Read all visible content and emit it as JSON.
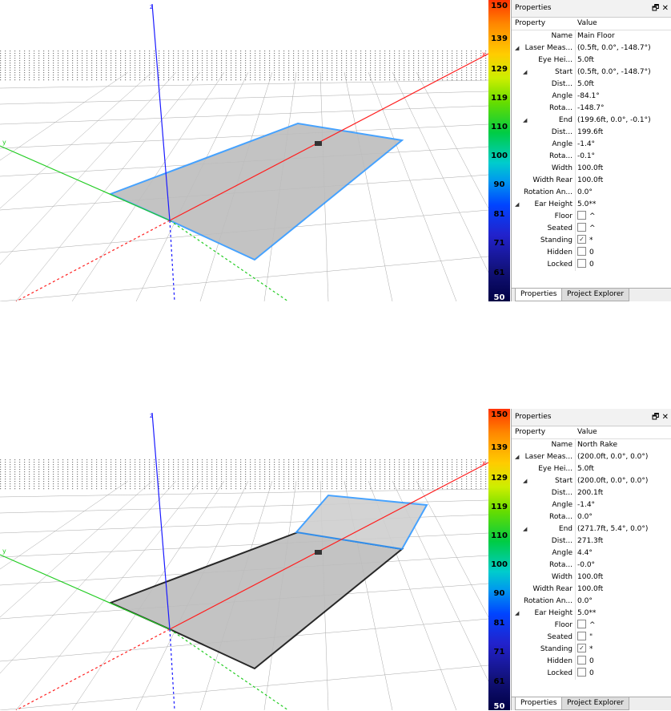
{
  "scale_labels": [
    "150",
    "139",
    "129",
    "119",
    "110",
    "100",
    "90",
    "81",
    "71",
    "61",
    "50"
  ],
  "axis_labels": {
    "z": "z",
    "y": "y",
    "x": "x"
  },
  "panels": [
    {
      "title": "Properties",
      "title_controls": "🗗 ✕",
      "col_property": "Property",
      "col_value": "Value",
      "rows": [
        {
          "name": "Name",
          "value": "Main Floor",
          "indent": 0,
          "expander": ""
        },
        {
          "name": "Laser Meas...",
          "value": "(0.5ft, 0.0°, -148.7°)",
          "indent": 0,
          "expander": "◢"
        },
        {
          "name": "Eye Hei...",
          "value": "5.0ft",
          "indent": 1,
          "expander": ""
        },
        {
          "name": "Start",
          "value": "(0.5ft, 0.0°, -148.7°)",
          "indent": 1,
          "expander": "◢"
        },
        {
          "name": "Dist...",
          "value": "5.0ft",
          "indent": 2,
          "expander": ""
        },
        {
          "name": "Angle",
          "value": "-84.1°",
          "indent": 2,
          "expander": ""
        },
        {
          "name": "Rota...",
          "value": "-148.7°",
          "indent": 2,
          "expander": ""
        },
        {
          "name": "End",
          "value": "(199.6ft, 0.0°, -0.1°)",
          "indent": 1,
          "expander": "◢"
        },
        {
          "name": "Dist...",
          "value": "199.6ft",
          "indent": 2,
          "expander": ""
        },
        {
          "name": "Angle",
          "value": "-1.4°",
          "indent": 2,
          "expander": ""
        },
        {
          "name": "Rota...",
          "value": "-0.1°",
          "indent": 2,
          "expander": ""
        },
        {
          "name": "Width",
          "value": "100.0ft",
          "indent": 0,
          "expander": ""
        },
        {
          "name": "Width Rear",
          "value": "100.0ft",
          "indent": 0,
          "expander": ""
        },
        {
          "name": "Rotation An...",
          "value": "0.0°",
          "indent": 0,
          "expander": ""
        },
        {
          "name": "Ear Height",
          "value": "5.0**",
          "indent": 0,
          "expander": "◢"
        },
        {
          "name": "Floor",
          "value": "^",
          "indent": 1,
          "expander": "",
          "checkbox": true,
          "checked": false
        },
        {
          "name": "Seated",
          "value": "^",
          "indent": 1,
          "expander": "",
          "checkbox": true,
          "checked": false
        },
        {
          "name": "Standing",
          "value": "*",
          "indent": 1,
          "expander": "",
          "checkbox": true,
          "checked": true
        },
        {
          "name": "Hidden",
          "value": "0",
          "indent": 0,
          "expander": "",
          "checkbox": true,
          "checked": false
        },
        {
          "name": "Locked",
          "value": "0",
          "indent": 0,
          "expander": "",
          "checkbox": true,
          "checked": false
        }
      ],
      "tabs": [
        "Properties",
        "Project Explorer"
      ]
    },
    {
      "title": "Properties",
      "title_controls": "🗗 ✕",
      "col_property": "Property",
      "col_value": "Value",
      "rows": [
        {
          "name": "Name",
          "value": "North Rake",
          "indent": 0,
          "expander": ""
        },
        {
          "name": "Laser Meas...",
          "value": "(200.0ft, 0.0°, 0.0°)",
          "indent": 0,
          "expander": "◢"
        },
        {
          "name": "Eye Hei...",
          "value": "5.0ft",
          "indent": 1,
          "expander": ""
        },
        {
          "name": "Start",
          "value": "(200.0ft, 0.0°, 0.0°)",
          "indent": 1,
          "expander": "◢"
        },
        {
          "name": "Dist...",
          "value": "200.1ft",
          "indent": 2,
          "expander": ""
        },
        {
          "name": "Angle",
          "value": "-1.4°",
          "indent": 2,
          "expander": ""
        },
        {
          "name": "Rota...",
          "value": "0.0°",
          "indent": 2,
          "expander": ""
        },
        {
          "name": "End",
          "value": "(271.7ft, 5.4°, 0.0°)",
          "indent": 1,
          "expander": "◢"
        },
        {
          "name": "Dist...",
          "value": "271.3ft",
          "indent": 2,
          "expander": ""
        },
        {
          "name": "Angle",
          "value": "4.4°",
          "indent": 2,
          "expander": ""
        },
        {
          "name": "Rota...",
          "value": "-0.0°",
          "indent": 2,
          "expander": ""
        },
        {
          "name": "Width",
          "value": "100.0ft",
          "indent": 0,
          "expander": ""
        },
        {
          "name": "Width Rear",
          "value": "100.0ft",
          "indent": 0,
          "expander": ""
        },
        {
          "name": "Rotation An...",
          "value": "0.0°",
          "indent": 0,
          "expander": ""
        },
        {
          "name": "Ear Height",
          "value": "5.0**",
          "indent": 0,
          "expander": "◢"
        },
        {
          "name": "Floor",
          "value": "^",
          "indent": 1,
          "expander": "",
          "checkbox": true,
          "checked": false
        },
        {
          "name": "Seated",
          "value": "\"",
          "indent": 1,
          "expander": "",
          "checkbox": true,
          "checked": false
        },
        {
          "name": "Standing",
          "value": "*",
          "indent": 1,
          "expander": "",
          "checkbox": true,
          "checked": true
        },
        {
          "name": "Hidden",
          "value": "0",
          "indent": 0,
          "expander": "",
          "checkbox": true,
          "checked": false
        },
        {
          "name": "Locked",
          "value": "0",
          "indent": 0,
          "expander": "",
          "checkbox": true,
          "checked": false
        }
      ],
      "tabs": [
        "Properties",
        "Project Explorer"
      ]
    }
  ],
  "colors": {
    "axis_z": "#1a1aff",
    "axis_x": "#ff2020",
    "axis_y": "#22cc22",
    "surface_fill": "#bdbdbd",
    "surface_selected_edge": "#3399ff",
    "surface_edge": "#111111",
    "grid": "#9a9a9a"
  }
}
